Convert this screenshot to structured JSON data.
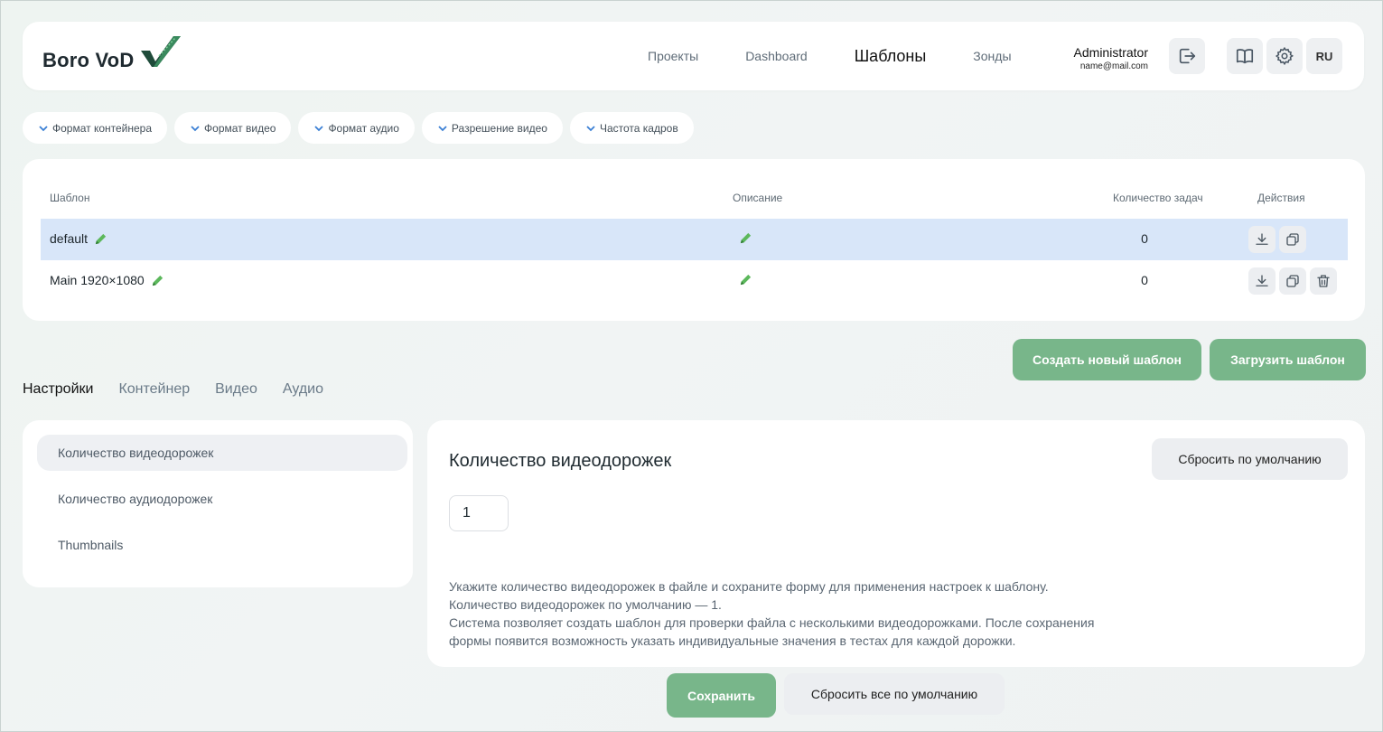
{
  "header": {
    "logo_text": "Boro VoD",
    "nav": [
      {
        "label": "Проекты",
        "active": false
      },
      {
        "label": "Dashboard",
        "active": false
      },
      {
        "label": "Шаблоны",
        "active": true
      },
      {
        "label": "Зонды",
        "active": false
      }
    ],
    "user": {
      "name": "Administrator",
      "email": "name@mail.com"
    },
    "lang": "RU",
    "icons": [
      "logout-icon",
      "book-icon",
      "gear-icon"
    ]
  },
  "filters": [
    {
      "label": "Формат контейнера"
    },
    {
      "label": "Формат видео"
    },
    {
      "label": "Формат аудио"
    },
    {
      "label": "Разрешение видео"
    },
    {
      "label": "Частота кадров"
    }
  ],
  "table": {
    "headers": {
      "name": "Шаблон",
      "description": "Описание",
      "count": "Количество задач",
      "actions": "Действия"
    },
    "rows": [
      {
        "name": "default",
        "count": "0",
        "selected": true,
        "actions": [
          "download-icon",
          "copy-icon"
        ]
      },
      {
        "name": "Main 1920×1080",
        "count": "0",
        "selected": false,
        "actions": [
          "download-icon",
          "copy-icon",
          "trash-icon"
        ]
      }
    ]
  },
  "buttons": {
    "create_template": "Создать новый шаблон",
    "upload_template": "Загрузить шаблон",
    "save": "Сохранить",
    "reset_all": "Сбросить все по умолчанию",
    "reset_default": "Сбросить по умолчанию"
  },
  "tabs": [
    {
      "label": "Настройки",
      "active": true
    },
    {
      "label": "Контейнер",
      "active": false
    },
    {
      "label": "Видео",
      "active": false
    },
    {
      "label": "Аудио",
      "active": false
    }
  ],
  "settings_menu": [
    {
      "label": "Количество видеодорожек",
      "active": true
    },
    {
      "label": "Количество аудиодорожек",
      "active": false
    },
    {
      "label": "Thumbnails",
      "active": false
    }
  ],
  "detail": {
    "title": "Количество видеодорожек",
    "value": "1",
    "help": [
      "Укажите количество видеодорожек в файле и сохраните форму для применения настроек к шаблону.",
      "Количество видеодорожек по умолчанию — 1.",
      "Система позволяет создать шаблон для проверки файла с несколькими видеодорожками. После сохранения",
      "формы появится возможность указать индивидуальные значения в тестах для каждой дорожки."
    ]
  },
  "colors": {
    "accent_green": "#78b68a",
    "selected_row": "#d8e6f9",
    "chevron_blue": "#3b7fd4",
    "edit_green": "#4caf50"
  }
}
